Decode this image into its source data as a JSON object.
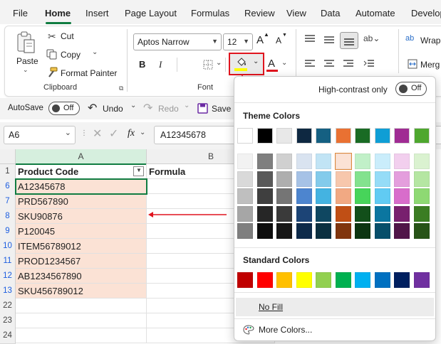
{
  "tabs": [
    "File",
    "Home",
    "Insert",
    "Page Layout",
    "Formulas",
    "Review",
    "View",
    "Data",
    "Automate",
    "Develop"
  ],
  "clipboard": {
    "paste": "Paste",
    "cut": "Cut",
    "copy": "Copy",
    "format_painter": "Format Painter",
    "label": "Clipboard"
  },
  "font": {
    "name": "Aptos Narrow",
    "size": "12",
    "bold": "B",
    "italic": "I",
    "label": "Font",
    "grow": "A",
    "shrink": "A",
    "font_color": "A"
  },
  "alignment": {
    "wrap": "Wrap",
    "merge": "Merg"
  },
  "qat": {
    "autosave": "AutoSave",
    "off": "Off",
    "undo": "Undo",
    "redo": "Redo",
    "save": "Save"
  },
  "formula_bar": {
    "name_box": "A6",
    "fx": "fx",
    "content": "A12345678"
  },
  "grid": {
    "columns": [
      "A",
      "B"
    ],
    "header": {
      "row": "1",
      "a": "Product Code",
      "b": "Formula"
    },
    "rows": [
      {
        "num": "6",
        "value": "A12345678"
      },
      {
        "num": "7",
        "value": "PRD567890"
      },
      {
        "num": "8",
        "value": "SKU90876"
      },
      {
        "num": "9",
        "value": "P120045"
      },
      {
        "num": "10",
        "value": "ITEM56789012"
      },
      {
        "num": "11",
        "value": "PROD1234567"
      },
      {
        "num": "12",
        "value": "AB1234567890"
      },
      {
        "num": "13",
        "value": "SKU456789012"
      }
    ],
    "empty_rows": [
      "22",
      "23",
      "24"
    ]
  },
  "panel": {
    "high_contrast": "High-contrast only",
    "off": "Off",
    "theme_colors": "Theme Colors",
    "standard_colors": "Standard Colors",
    "no_fill": "No Fill",
    "more_colors": "More Colors...",
    "theme_top": [
      "#ffffff",
      "#000000",
      "#e8e8e8",
      "#0e2841",
      "#156082",
      "#e97132",
      "#196b24",
      "#0f9ed5",
      "#a02b93",
      "#4ea72e"
    ],
    "theme_shades": [
      [
        "#f2f2f2",
        "#7f7f7f",
        "#d0d0d0",
        "#d9e3f0",
        "#c1e4f5",
        "#fbe2d5",
        "#c1f0c8",
        "#caedfb",
        "#f2cfee",
        "#daf2d0"
      ],
      [
        "#d9d9d9",
        "#595959",
        "#aeaeae",
        "#a6c2e6",
        "#83cbeb",
        "#f7c7ac",
        "#83e28e",
        "#95dcf7",
        "#e49edd",
        "#b5e6a2"
      ],
      [
        "#bfbfbf",
        "#3f3f3f",
        "#757575",
        "#4d85cf",
        "#44b3e1",
        "#f1a983",
        "#47d45a",
        "#61cbf3",
        "#d86dcb",
        "#8ed973"
      ],
      [
        "#a6a6a6",
        "#262626",
        "#3a3a3a",
        "#1c4476",
        "#0f4761",
        "#c04f15",
        "#124f1a",
        "#0b76a0",
        "#78206e",
        "#3b7d23"
      ],
      [
        "#7f7f7f",
        "#0d0d0d",
        "#171717",
        "#0d2a4a",
        "#0a2f40",
        "#80350e",
        "#0c3511",
        "#074f6a",
        "#501549",
        "#275317"
      ]
    ],
    "standard": [
      "#c00000",
      "#ff0000",
      "#ffc000",
      "#ffff00",
      "#92d050",
      "#00b050",
      "#00b0f0",
      "#0070c0",
      "#002060",
      "#7030a0"
    ],
    "selected_color": "#fbe2d5"
  },
  "colors": {
    "accent": "#107c41",
    "annotation_red": "#e0141e",
    "fill_highlight": "#fbe2d5",
    "row_blue": "#1d5ee0"
  }
}
